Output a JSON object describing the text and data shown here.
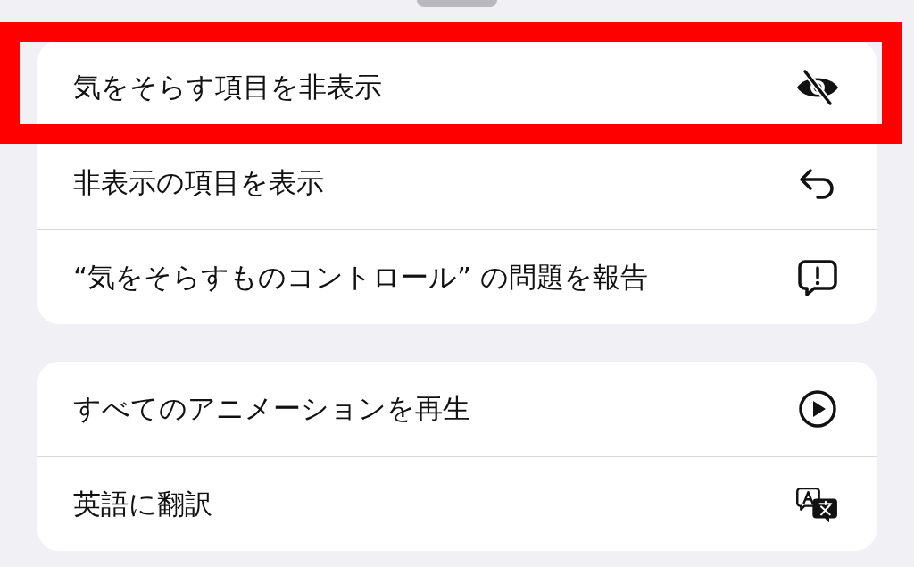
{
  "groups": [
    {
      "items": [
        {
          "label": "気をそらす項目を非表示",
          "kind": "eye-slash",
          "highlighted": true
        },
        {
          "label": "非表示の項目を表示",
          "kind": "undo",
          "highlighted": false
        },
        {
          "label": "“気をそらすものコントロール” の問題を報告",
          "kind": "report",
          "highlighted": false
        }
      ]
    },
    {
      "items": [
        {
          "label": "すべてのアニメーションを再生",
          "kind": "play",
          "highlighted": false
        },
        {
          "label": "英語に翻訳",
          "kind": "translate",
          "highlighted": false
        }
      ]
    }
  ]
}
